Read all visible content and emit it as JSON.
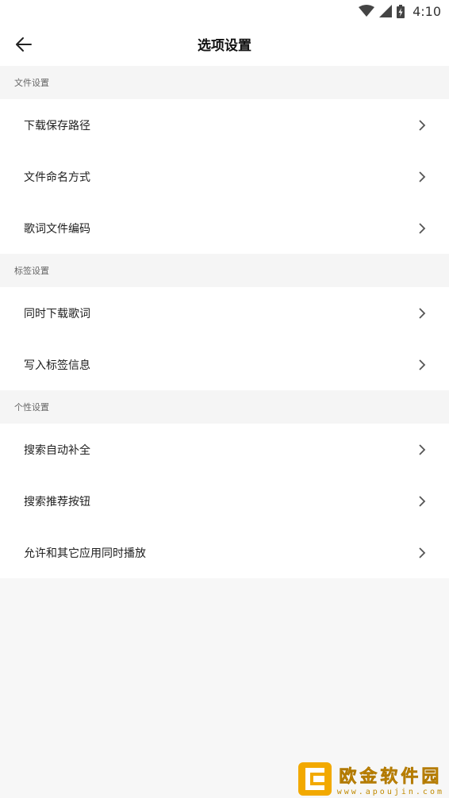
{
  "status_bar": {
    "time": "4:10",
    "icons": [
      "wifi-icon",
      "signal-icon",
      "battery-charging-icon"
    ]
  },
  "app_bar": {
    "title": "选项设置",
    "back_icon": "arrow-left-icon"
  },
  "sections": [
    {
      "header": "文件设置",
      "items": [
        {
          "label": "下载保存路径"
        },
        {
          "label": "文件命名方式"
        },
        {
          "label": "歌词文件编码"
        }
      ]
    },
    {
      "header": "标签设置",
      "items": [
        {
          "label": "同时下载歌词"
        },
        {
          "label": "写入标签信息"
        }
      ]
    },
    {
      "header": "个性设置",
      "items": [
        {
          "label": "搜索自动补全"
        },
        {
          "label": "搜索推荐按钮"
        },
        {
          "label": "允许和其它应用同时播放"
        }
      ]
    }
  ],
  "watermark": {
    "brand": "欧金软件园",
    "url": "www.apoujin.com"
  },
  "colors": {
    "background": "#f7f7f7",
    "section_header_bg": "#f5f5f5",
    "item_bg": "#ffffff",
    "watermark": "#f2a900"
  }
}
